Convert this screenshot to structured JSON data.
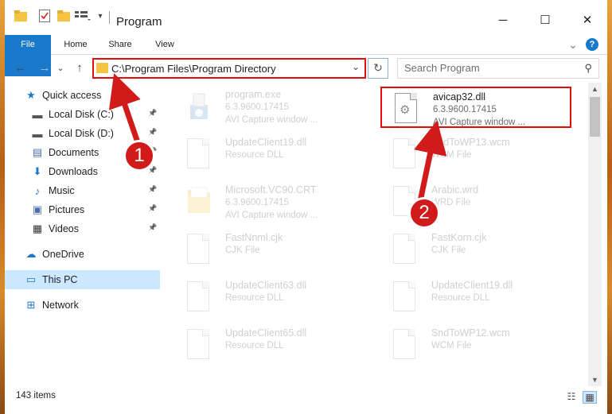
{
  "window": {
    "title": "Program",
    "controls": {
      "minimize": "─",
      "maximize": "☐",
      "close": "✕"
    }
  },
  "ribbon": {
    "tabs": [
      {
        "label": "File"
      },
      {
        "label": "Home"
      },
      {
        "label": "Share"
      },
      {
        "label": "View"
      }
    ],
    "expand": "⌄",
    "help": "?"
  },
  "navigation": {
    "back": "←",
    "forward": "→",
    "recent": "⌄",
    "up": "↑",
    "address": "C:\\Program Files\\Program Directory",
    "address_dropdown": "⌄",
    "refresh": "↻",
    "search_placeholder": "Search Program",
    "search_icon": "⚲"
  },
  "sidebar": {
    "items": [
      {
        "label": "Quick access",
        "icon": "star-icon",
        "glyph": "★",
        "color": "#1f77c8",
        "pinned": false
      },
      {
        "label": "Local Disk (C:)",
        "icon": "drive-icon",
        "glyph": "▬",
        "color": "#555555",
        "pinned": true
      },
      {
        "label": "Local Disk (D:)",
        "icon": "drive-icon",
        "glyph": "▬",
        "color": "#555555",
        "pinned": true
      },
      {
        "label": "Documents",
        "icon": "documents-icon",
        "glyph": "▤",
        "color": "#4a6ea8",
        "pinned": true
      },
      {
        "label": "Downloads",
        "icon": "downloads-icon",
        "glyph": "⬇",
        "color": "#1f77c8",
        "pinned": true
      },
      {
        "label": "Music",
        "icon": "music-icon",
        "glyph": "♪",
        "color": "#1f77c8",
        "pinned": true
      },
      {
        "label": "Pictures",
        "icon": "pictures-icon",
        "glyph": "▣",
        "color": "#4a6ea8",
        "pinned": true
      },
      {
        "label": "Videos",
        "icon": "videos-icon",
        "glyph": "▦",
        "color": "#333333",
        "pinned": true
      },
      {
        "label": "OneDrive",
        "icon": "onedrive-icon",
        "glyph": "☁",
        "color": "#1f77c8",
        "pinned": false
      },
      {
        "label": "This PC",
        "icon": "this-pc-icon",
        "glyph": "▭",
        "color": "#1f77c8",
        "pinned": false,
        "selected": true
      },
      {
        "label": "Network",
        "icon": "network-icon",
        "glyph": "⊞",
        "color": "#1f77c8",
        "pinned": false
      }
    ],
    "pin_glyph": "📌"
  },
  "files": [
    {
      "name": "program.exe",
      "line2": "6.3.9600.17415",
      "line3": "AVI Capture window ...",
      "icon": "installer-icon"
    },
    {
      "name": "avicap32.dll",
      "line2": "6.3.9600.17415",
      "line3": "AVI Capture window ...",
      "icon": "dll-file-icon",
      "highlighted": true
    },
    {
      "name": "UpdateClient19.dll",
      "line2": "Resource DLL",
      "line3": "",
      "icon": "file-icon"
    },
    {
      "name": "SndToWP13.wcm",
      "line2": "WCM File",
      "line3": "",
      "icon": "file-icon"
    },
    {
      "name": "Microsoft.VC90.CRT",
      "line2": "6.3.9600.17415",
      "line3": "AVI Capture window ...",
      "icon": "folder-icon"
    },
    {
      "name": "Arabic.wrd",
      "line2": "WRD File",
      "line3": "",
      "icon": "file-icon"
    },
    {
      "name": "FastNnml.cjk",
      "line2": "CJK File",
      "line3": "",
      "icon": "file-icon"
    },
    {
      "name": "FastKorn.cjk",
      "line2": "CJK File",
      "line3": "",
      "icon": "file-icon"
    },
    {
      "name": "UpdateClient63.dll",
      "line2": "Resource DLL",
      "line3": "",
      "icon": "file-icon"
    },
    {
      "name": "UpdateClient19.dll",
      "line2": "Resource DLL",
      "line3": "",
      "icon": "file-icon"
    },
    {
      "name": "UpdateClient65.dll",
      "line2": "Resource DLL",
      "line3": "",
      "icon": "file-icon"
    },
    {
      "name": "SndToWP12.wcm",
      "line2": "WCM File",
      "line3": "",
      "icon": "file-icon"
    }
  ],
  "status": {
    "item_count": "143 items",
    "details_view": "☷",
    "tiles_view": "▦"
  },
  "annotations": [
    {
      "number": "1"
    },
    {
      "number": "2"
    }
  ],
  "colors": {
    "accent": "#1979ca",
    "highlight_red": "#e30b0b",
    "selected_bg": "#cce8ff"
  }
}
